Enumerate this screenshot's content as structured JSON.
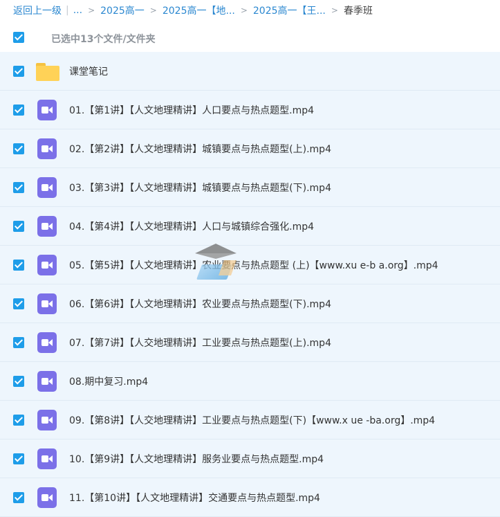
{
  "breadcrumb": {
    "back": "返回上一级",
    "ellipsis": "...",
    "items": [
      "2025高一",
      "2025高一【地...",
      "2025高一【王...",
      "春季班"
    ]
  },
  "selection": {
    "text": "已选中13个文件/文件夹"
  },
  "files": [
    {
      "type": "folder",
      "name": "课堂笔记"
    },
    {
      "type": "video",
      "name": "01.【第1讲】【人文地理精讲】人口要点与热点题型.mp4"
    },
    {
      "type": "video",
      "name": "02.【第2讲】【人文地理精讲】城镇要点与热点题型(上).mp4"
    },
    {
      "type": "video",
      "name": "03.【第3讲】【人文地理精讲】城镇要点与热点题型(下).mp4"
    },
    {
      "type": "video",
      "name": "04.【第4讲】【人文地理精讲】人口与城镇综合强化.mp4"
    },
    {
      "type": "video",
      "name": "05.【第5讲】【人文地理精讲】农业要点与热点题型 (上)【www.xu e-b a.org】.mp4"
    },
    {
      "type": "video",
      "name": "06.【第6讲】【人文地理精讲】农业要点与热点题型(下).mp4"
    },
    {
      "type": "video",
      "name": "07.【第7讲】【人交地理精讲】工业要点与热点题型(上).mp4"
    },
    {
      "type": "video",
      "name": "08.期中复习.mp4"
    },
    {
      "type": "video",
      "name": "09.【第8讲】【人交地理精讲】工业要点与热点题型(下)【www.x ue -ba.org】.mp4"
    },
    {
      "type": "video",
      "name": "10.【第9讲】【人文地理精讲】服务业要点与热点题型.mp4"
    },
    {
      "type": "video",
      "name": "11.【第10讲】【人文地理精讲】交通要点与热点题型.mp4"
    }
  ],
  "colors": {
    "accent": "#1e9de9",
    "link": "#2a87d0",
    "row_bg": "#eef6fd",
    "folder": "#ffd257",
    "video": "#7b70e8"
  },
  "icons": {
    "folder": "folder-icon",
    "video": "video-file-icon",
    "checkbox": "checkbox-checked-icon"
  }
}
